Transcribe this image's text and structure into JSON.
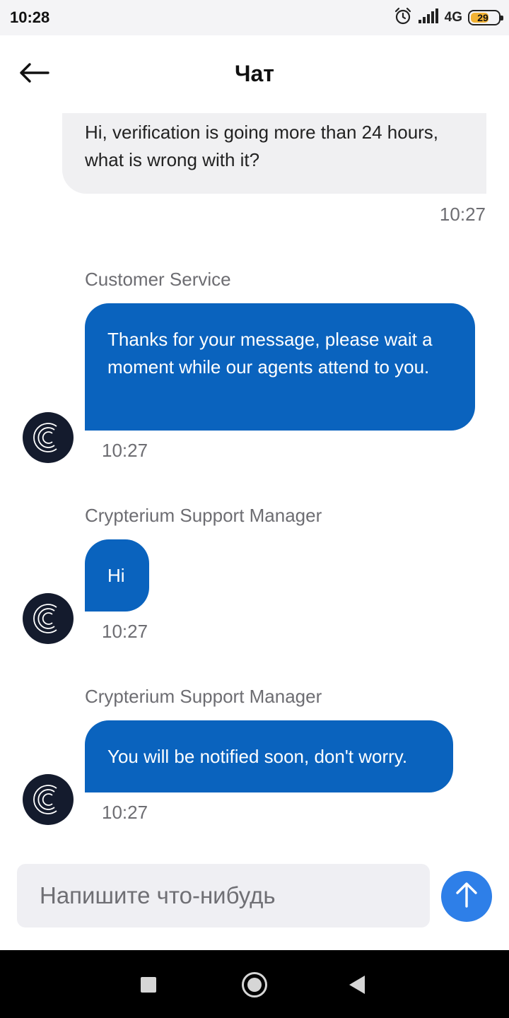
{
  "status_bar": {
    "time": "10:28",
    "network": "4G",
    "battery": "29",
    "icons": [
      "alarm-icon",
      "signal-icon",
      "battery-icon"
    ]
  },
  "header": {
    "title": "Чат",
    "back_icon": "arrow-left-icon"
  },
  "messages": {
    "outgoing": {
      "text": "Hi, verification is going more than 24 hours, what is wrong with it?",
      "time": "10:27"
    },
    "incoming": [
      {
        "sender": "Customer Service",
        "text": "Thanks for your message, please wait a moment while our agents attend to you.",
        "time": "10:27"
      },
      {
        "sender": "Crypterium Support Manager",
        "text": "Hi",
        "time": "10:27"
      },
      {
        "sender": "Crypterium Support Manager",
        "text": "You will be notified soon, don't worry.",
        "time": "10:27"
      }
    ]
  },
  "composer": {
    "placeholder": "Напишите что-нибудь",
    "value": "",
    "send_icon": "arrow-up-icon"
  },
  "nav_bar": {
    "icons": [
      "recents-icon",
      "home-icon",
      "back-icon"
    ]
  },
  "colors": {
    "accent": "#0a63be",
    "send_button": "#2e7fe8",
    "outgoing_bubble": "#f0f0f2",
    "avatar": "#141b2d"
  }
}
